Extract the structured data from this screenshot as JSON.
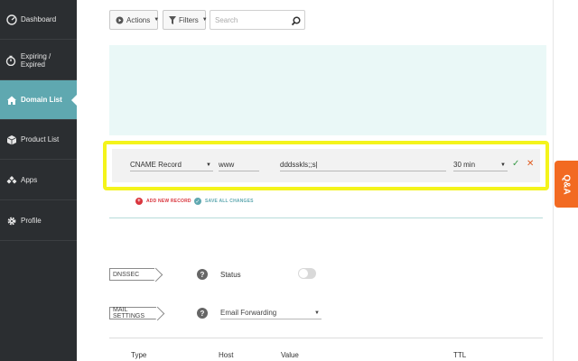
{
  "sidebar": {
    "items": [
      {
        "label": "Dashboard",
        "icon": "dashboard-icon"
      },
      {
        "label": "Expiring / Expired",
        "icon": "timer-icon"
      },
      {
        "label": "Domain List",
        "icon": "home-icon",
        "active": true
      },
      {
        "label": "Product List",
        "icon": "box-icon"
      },
      {
        "label": "Apps",
        "icon": "apps-icon"
      },
      {
        "label": "Profile",
        "icon": "gear-icon"
      }
    ]
  },
  "toolbar": {
    "actions_label": "Actions",
    "filters_label": "Filters",
    "search_placeholder": "Search"
  },
  "record": {
    "type": "CNAME Record",
    "host": "www",
    "value": "dddsskls;;s|",
    "ttl": "30 min"
  },
  "record_actions": {
    "add_new": "ADD NEW RECORD",
    "save_all": "SAVE ALL CHANGES"
  },
  "dnssec": {
    "tag": "DNSSEC",
    "help": "?",
    "status_label": "Status",
    "enabled": false
  },
  "mail": {
    "tag": "MAIL SETTINGS",
    "help": "?",
    "selected": "Email Forwarding"
  },
  "table": {
    "columns": [
      "Type",
      "Host",
      "Value",
      "TTL"
    ]
  },
  "qa_label": "Q&A",
  "colors": {
    "sidebar_bg": "#2b2e31",
    "active": "#5fa8b0",
    "highlight": "#f4f41b",
    "mint": "#eaf8f7",
    "qa": "#f26a22",
    "confirm": "#3a9b4a",
    "cancel": "#e05a1e"
  }
}
